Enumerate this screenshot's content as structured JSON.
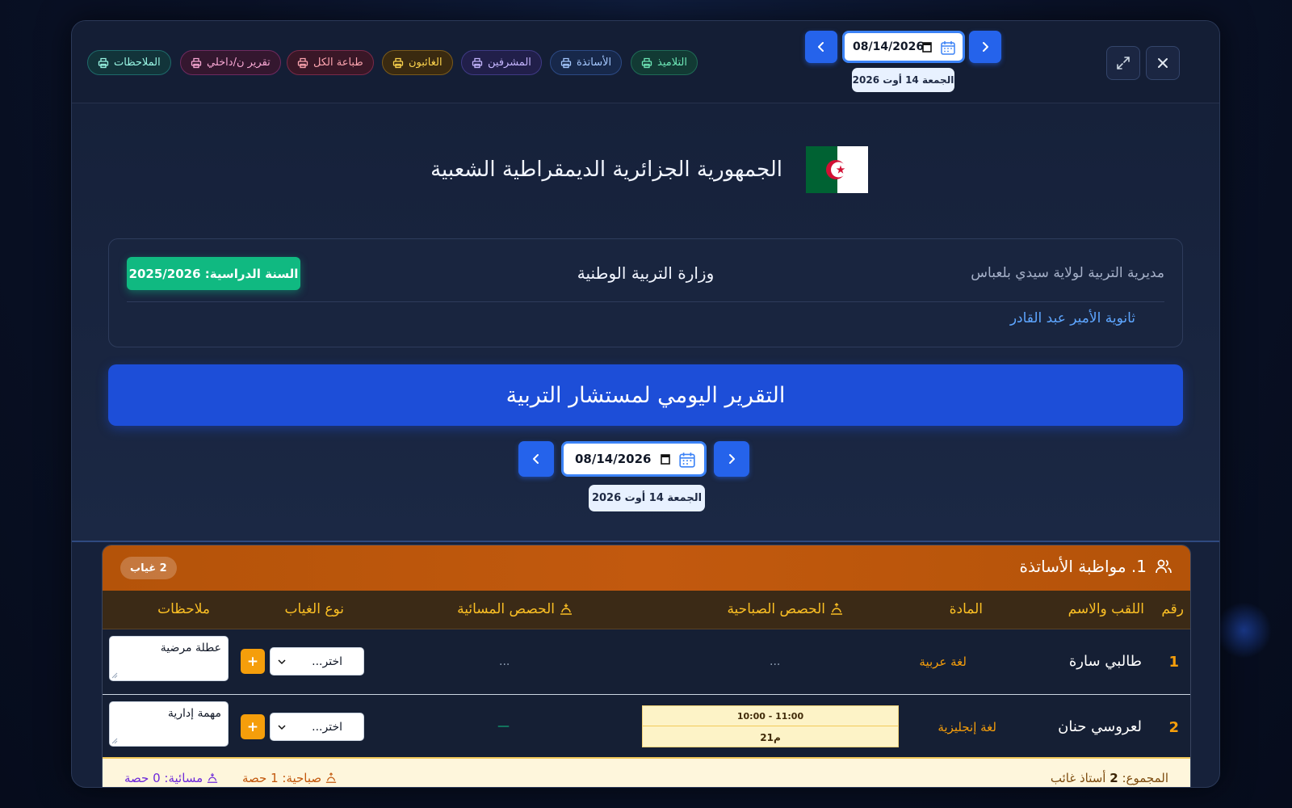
{
  "toolbar": {
    "print_buttons": [
      {
        "label": "التلاميذ",
        "color": "#6ee7b7",
        "bg": "#123a34",
        "border": "#1f6b56"
      },
      {
        "label": "الأساتذة",
        "color": "#a5c8ff",
        "bg": "#17284a",
        "border": "#2c4a85"
      },
      {
        "label": "المشرفين",
        "color": "#c4b5fd",
        "bg": "#211f4a",
        "border": "#3f3a85"
      },
      {
        "label": "الغائبون",
        "color": "#fcd34d",
        "bg": "#3a2a10",
        "border": "#7a5a1a"
      },
      {
        "label": "طباعة الكل",
        "color": "#fda4af",
        "bg": "#3a1727",
        "border": "#7a2a48"
      },
      {
        "label": "تقرير ن/داخلي",
        "color": "#f9a8d4",
        "bg": "#34172f",
        "border": "#6f2a5f"
      },
      {
        "label": "الملاحظات",
        "color": "#99f6e4",
        "bg": "#12343a",
        "border": "#1e6a6a"
      }
    ],
    "date_value": "08/14/2026",
    "date_caption": "الجمعة 14 أوت 2026",
    "icons": {
      "prev": "chevron-left-icon",
      "next": "chevron-right-icon",
      "expand": "expand-icon",
      "close": "close-icon",
      "calendar": "calendar-icon",
      "print": "printer-icon"
    }
  },
  "header": {
    "republic_title": "الجمهورية الجزائرية الديمقراطية الشعبية",
    "directorate": "مديرية التربية لولاية سيدي بلعباس",
    "ministry": "وزارة التربية الوطنية",
    "school_year": "السنة الدراسية: 2025/2026",
    "school_name": "ثانوية الأمير عبد القادر",
    "report_title": "التقرير اليومي لمستشار التربية",
    "date_value": "08/14/2026",
    "date_caption": "الجمعة 14 أوت 2026"
  },
  "section": {
    "title": "1. مواظبة الأساتذة",
    "absence_badge": "2 غياب",
    "columns": {
      "num": "رقم",
      "name": "اللقب والاسم",
      "subject": "المادة",
      "morning": "الحصص الصباحية",
      "evening": "الحصص المسائية",
      "absence_type": "نوع الغياب",
      "notes": "ملاحظات"
    },
    "rows": [
      {
        "num": "1",
        "name": "طالبي سارة",
        "subject": "لغة عربية",
        "morning": "...",
        "evening": "...",
        "absence_type": "اختر...",
        "note": "عطلة مرضية"
      },
      {
        "num": "2",
        "name": "لعروسي حنان",
        "subject": "لغة إنجليزية",
        "morning_time": "10:00 - 11:00",
        "morning_class": "2م1",
        "evening": "—",
        "absence_type": "اختر...",
        "note": "مهمة إدارية"
      }
    ],
    "plus_label": "+",
    "summary": {
      "total_prefix": "المجموع:",
      "total_count": "2",
      "total_suffix": "أستاذ غائب",
      "morning": "صباحية: 1 حصة",
      "evening": "مسائية: 0 حصة"
    }
  },
  "colors": {
    "accent": "#2563eb",
    "success": "#10b981",
    "section_header": "#c2590e",
    "highlight": "#f59e0b"
  }
}
